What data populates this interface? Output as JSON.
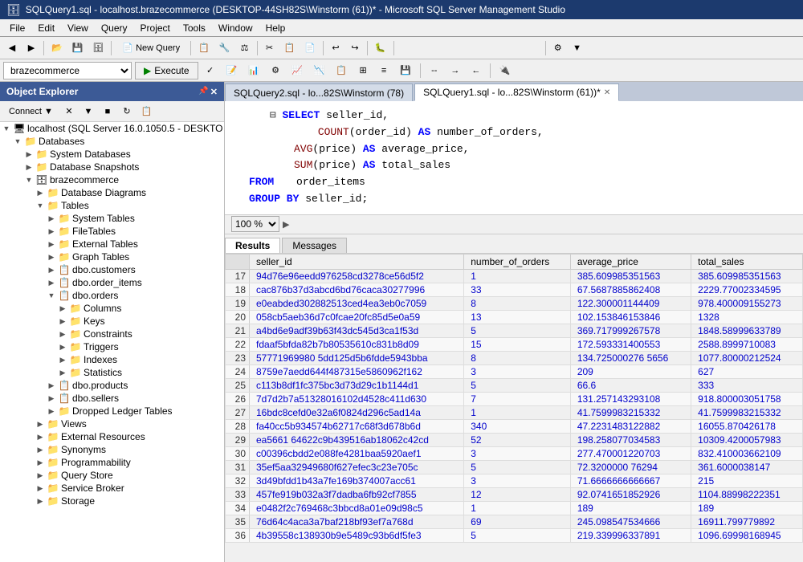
{
  "titleBar": {
    "text": "SQLQuery1.sql - localhost.brazecommerce (DESKTOP-44SH82S\\Winstorm (61))* - Microsoft SQL Server Management Studio"
  },
  "menu": {
    "items": [
      "File",
      "Edit",
      "View",
      "Query",
      "Project",
      "Tools",
      "Window",
      "Help"
    ]
  },
  "toolbar": {
    "newQuery": "New Query",
    "execute": "Execute",
    "database": "brazecommerce"
  },
  "objectExplorer": {
    "title": "Object Explorer",
    "connectBtn": "Connect",
    "tree": [
      {
        "id": "server",
        "label": "localhost (SQL Server 16.0.1050.5 - DESKTO",
        "level": 0,
        "expanded": true,
        "icon": "server"
      },
      {
        "id": "databases",
        "label": "Databases",
        "level": 1,
        "expanded": true,
        "icon": "folder"
      },
      {
        "id": "systemdb",
        "label": "System Databases",
        "level": 2,
        "expanded": false,
        "icon": "folder"
      },
      {
        "id": "snapshots",
        "label": "Database Snapshots",
        "level": 2,
        "expanded": false,
        "icon": "folder"
      },
      {
        "id": "brazecommerce",
        "label": "brazecommerce",
        "level": 2,
        "expanded": true,
        "icon": "database"
      },
      {
        "id": "dbdiagrams",
        "label": "Database Diagrams",
        "level": 3,
        "expanded": false,
        "icon": "folder"
      },
      {
        "id": "tables",
        "label": "Tables",
        "level": 3,
        "expanded": true,
        "icon": "folder"
      },
      {
        "id": "systemtables",
        "label": "System Tables",
        "level": 4,
        "expanded": false,
        "icon": "folder"
      },
      {
        "id": "filetables",
        "label": "FileTables",
        "level": 4,
        "expanded": false,
        "icon": "folder"
      },
      {
        "id": "externaltables",
        "label": "External Tables",
        "level": 4,
        "expanded": false,
        "icon": "folder"
      },
      {
        "id": "graphtables",
        "label": "Graph Tables",
        "level": 4,
        "expanded": false,
        "icon": "folder"
      },
      {
        "id": "customers",
        "label": "dbo.customers",
        "level": 4,
        "expanded": false,
        "icon": "table"
      },
      {
        "id": "orderitems",
        "label": "dbo.order_items",
        "level": 4,
        "expanded": false,
        "icon": "table"
      },
      {
        "id": "orders",
        "label": "dbo.orders",
        "level": 4,
        "expanded": true,
        "icon": "table"
      },
      {
        "id": "columns",
        "label": "Columns",
        "level": 5,
        "expanded": false,
        "icon": "folder"
      },
      {
        "id": "keys",
        "label": "Keys",
        "level": 5,
        "expanded": false,
        "icon": "folder"
      },
      {
        "id": "constraints",
        "label": "Constraints",
        "level": 5,
        "expanded": false,
        "icon": "folder"
      },
      {
        "id": "triggers",
        "label": "Triggers",
        "level": 5,
        "expanded": false,
        "icon": "folder"
      },
      {
        "id": "indexes",
        "label": "Indexes",
        "level": 5,
        "expanded": false,
        "icon": "folder"
      },
      {
        "id": "statistics",
        "label": "Statistics",
        "level": 5,
        "expanded": false,
        "icon": "folder"
      },
      {
        "id": "products",
        "label": "dbo.products",
        "level": 4,
        "expanded": false,
        "icon": "table"
      },
      {
        "id": "sellers",
        "label": "dbo.sellers",
        "level": 4,
        "expanded": false,
        "icon": "table"
      },
      {
        "id": "droppedledger",
        "label": "Dropped Ledger Tables",
        "level": 4,
        "expanded": false,
        "icon": "folder"
      },
      {
        "id": "views",
        "label": "Views",
        "level": 3,
        "expanded": false,
        "icon": "folder"
      },
      {
        "id": "extresources",
        "label": "External Resources",
        "level": 3,
        "expanded": false,
        "icon": "folder"
      },
      {
        "id": "synonyms",
        "label": "Synonyms",
        "level": 3,
        "expanded": false,
        "icon": "folder"
      },
      {
        "id": "programmability",
        "label": "Programmability",
        "level": 3,
        "expanded": false,
        "icon": "folder"
      },
      {
        "id": "querystore",
        "label": "Query Store",
        "level": 3,
        "expanded": false,
        "icon": "folder"
      },
      {
        "id": "servicebroker",
        "label": "Service Broker",
        "level": 3,
        "expanded": false,
        "icon": "folder"
      },
      {
        "id": "storage",
        "label": "Storage",
        "level": 3,
        "expanded": false,
        "icon": "folder"
      }
    ]
  },
  "tabs": [
    {
      "id": "tab1",
      "label": "SQLQuery2.sql - lo...82S\\Winstorm (78)",
      "active": false,
      "closable": false
    },
    {
      "id": "tab2",
      "label": "SQLQuery1.sql - lo...82S\\Winstorm (61))*",
      "active": true,
      "closable": true
    }
  ],
  "editor": {
    "lines": [
      {
        "num": "",
        "content": "SELECT seller_id,"
      },
      {
        "num": "",
        "content": "       COUNT(order_id) AS number_of_orders,"
      },
      {
        "num": "",
        "content": "       AVG(price) AS average_price,"
      },
      {
        "num": "",
        "content": "       SUM(price) AS total_sales"
      },
      {
        "num": "",
        "content": "FROM   order_items"
      },
      {
        "num": "",
        "content": "GROUP BY seller_id;"
      }
    ]
  },
  "zoom": "100 %",
  "resultsTabs": [
    "Results",
    "Messages"
  ],
  "activeResultsTab": "Results",
  "resultsColumns": [
    "",
    "seller_id",
    "number_of_orders",
    "average_price",
    "total_sales"
  ],
  "resultsRows": [
    [
      "17",
      "94d76e96eedd976258cd3278ce56d5f2",
      "1",
      "385.609985351563",
      "385.609985351563"
    ],
    [
      "18",
      "cac876b37d3abcd6bd76caca30277996",
      "33",
      "67.5687885862408",
      "2229.77002334595"
    ],
    [
      "19",
      "e0eabded302882513ced4ea3eb0c7059",
      "8",
      "122.300001144409",
      "978.400009155273"
    ],
    [
      "20",
      "058cb5aeb36d7c0fcae20fc85d5e0a59",
      "13",
      "102.153846153846",
      "1328"
    ],
    [
      "21",
      "a4bd6e9adf39b63f43dc545d3ca1f53d",
      "5",
      "369.717999267578",
      "1848.58999633789"
    ],
    [
      "22",
      "fdaaf5bfda82b7b80535610c831b8d09",
      "15",
      "172.593331400553",
      "2588.8999710083"
    ],
    [
      "23",
      "57771969980 5dd125d5b6fdde5943bba",
      "8",
      "134.725000276 5656",
      "1077.80000212524"
    ],
    [
      "24",
      "8759e7aedd644f487315e5860962f162",
      "3",
      "209",
      "627"
    ],
    [
      "25",
      "c113b8df1fc375bc3d73d29c1b1144d1",
      "5",
      "66.6",
      "333"
    ],
    [
      "26",
      "7d7d2b7a51328016102d4528c411d630",
      "7",
      "131.257143293108",
      "918.800003051758"
    ],
    [
      "27",
      "16bdc8cefd0e32a6f0824d296c5ad14a",
      "1",
      "41.7599983215332",
      "41.7599983215332"
    ],
    [
      "28",
      "fa40cc5b934574b62717c68f3d678b6d",
      "340",
      "47.2231483122882",
      "16055.870426178"
    ],
    [
      "29",
      "ea5661 64622c9b439516ab18062c42cd",
      "52",
      "198.258077034583",
      "10309.4200057983"
    ],
    [
      "30",
      "c00396cbdd2e088fe4281baa5920aef1",
      "3",
      "277.470001220703",
      "832.410003662109"
    ],
    [
      "31",
      "35ef5aa32949680f627efec3c23e705c",
      "5",
      "72.3200000 76294",
      "361.6000038147"
    ],
    [
      "32",
      "3d49bfdd1b43a7fe169b374007acc61",
      "3",
      "71.6666666666667",
      "215"
    ],
    [
      "33",
      "457fe919b032a3f7dadba6fb92cf7855",
      "12",
      "92.0741651852926",
      "1104.88998222351"
    ],
    [
      "34",
      "e0482f2c769468c3bbcd8a01e09d98c5",
      "1",
      "189",
      "189"
    ],
    [
      "35",
      "76d64c4aca3a7baf218bf93ef7a768d",
      "69",
      "245.098547534666",
      "16911.799779892"
    ],
    [
      "36",
      "4b39558c138930b9e5489c93b6df5fe3",
      "5",
      "219.339996337891",
      "1096.69998168945"
    ]
  ]
}
